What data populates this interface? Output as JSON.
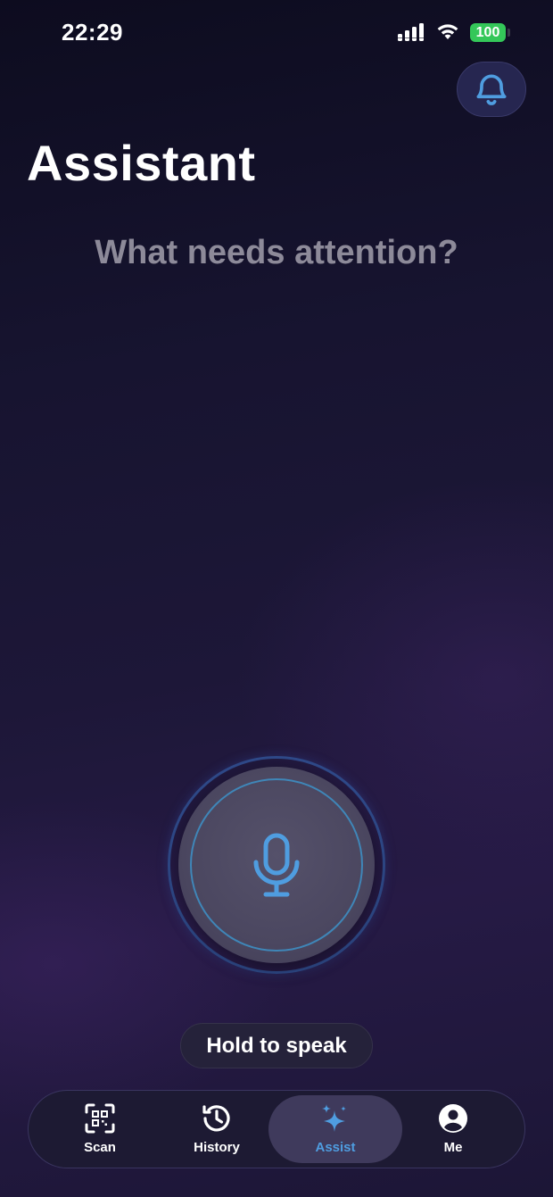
{
  "status_bar": {
    "time": "22:29",
    "battery": "100",
    "icons": [
      "signal-icon",
      "wifi-icon",
      "battery-icon"
    ]
  },
  "header": {
    "notification_icon": "bell-icon",
    "title": "Assistant"
  },
  "main": {
    "prompt": "What needs attention?",
    "mic_icon": "microphone-icon",
    "hold_label": "Hold to speak"
  },
  "tab_bar": {
    "active_index": 2,
    "tabs": [
      {
        "label": "Scan",
        "icon": "qr-scan-icon"
      },
      {
        "label": "History",
        "icon": "history-icon"
      },
      {
        "label": "Assist",
        "icon": "sparkles-icon"
      },
      {
        "label": "Me",
        "icon": "person-icon"
      }
    ]
  },
  "colors": {
    "accent": "#4f9de0",
    "battery": "#34c759",
    "prompt_text": "#8d8a99",
    "background_top": "#0d0c1f",
    "background_bottom": "#261a45"
  }
}
